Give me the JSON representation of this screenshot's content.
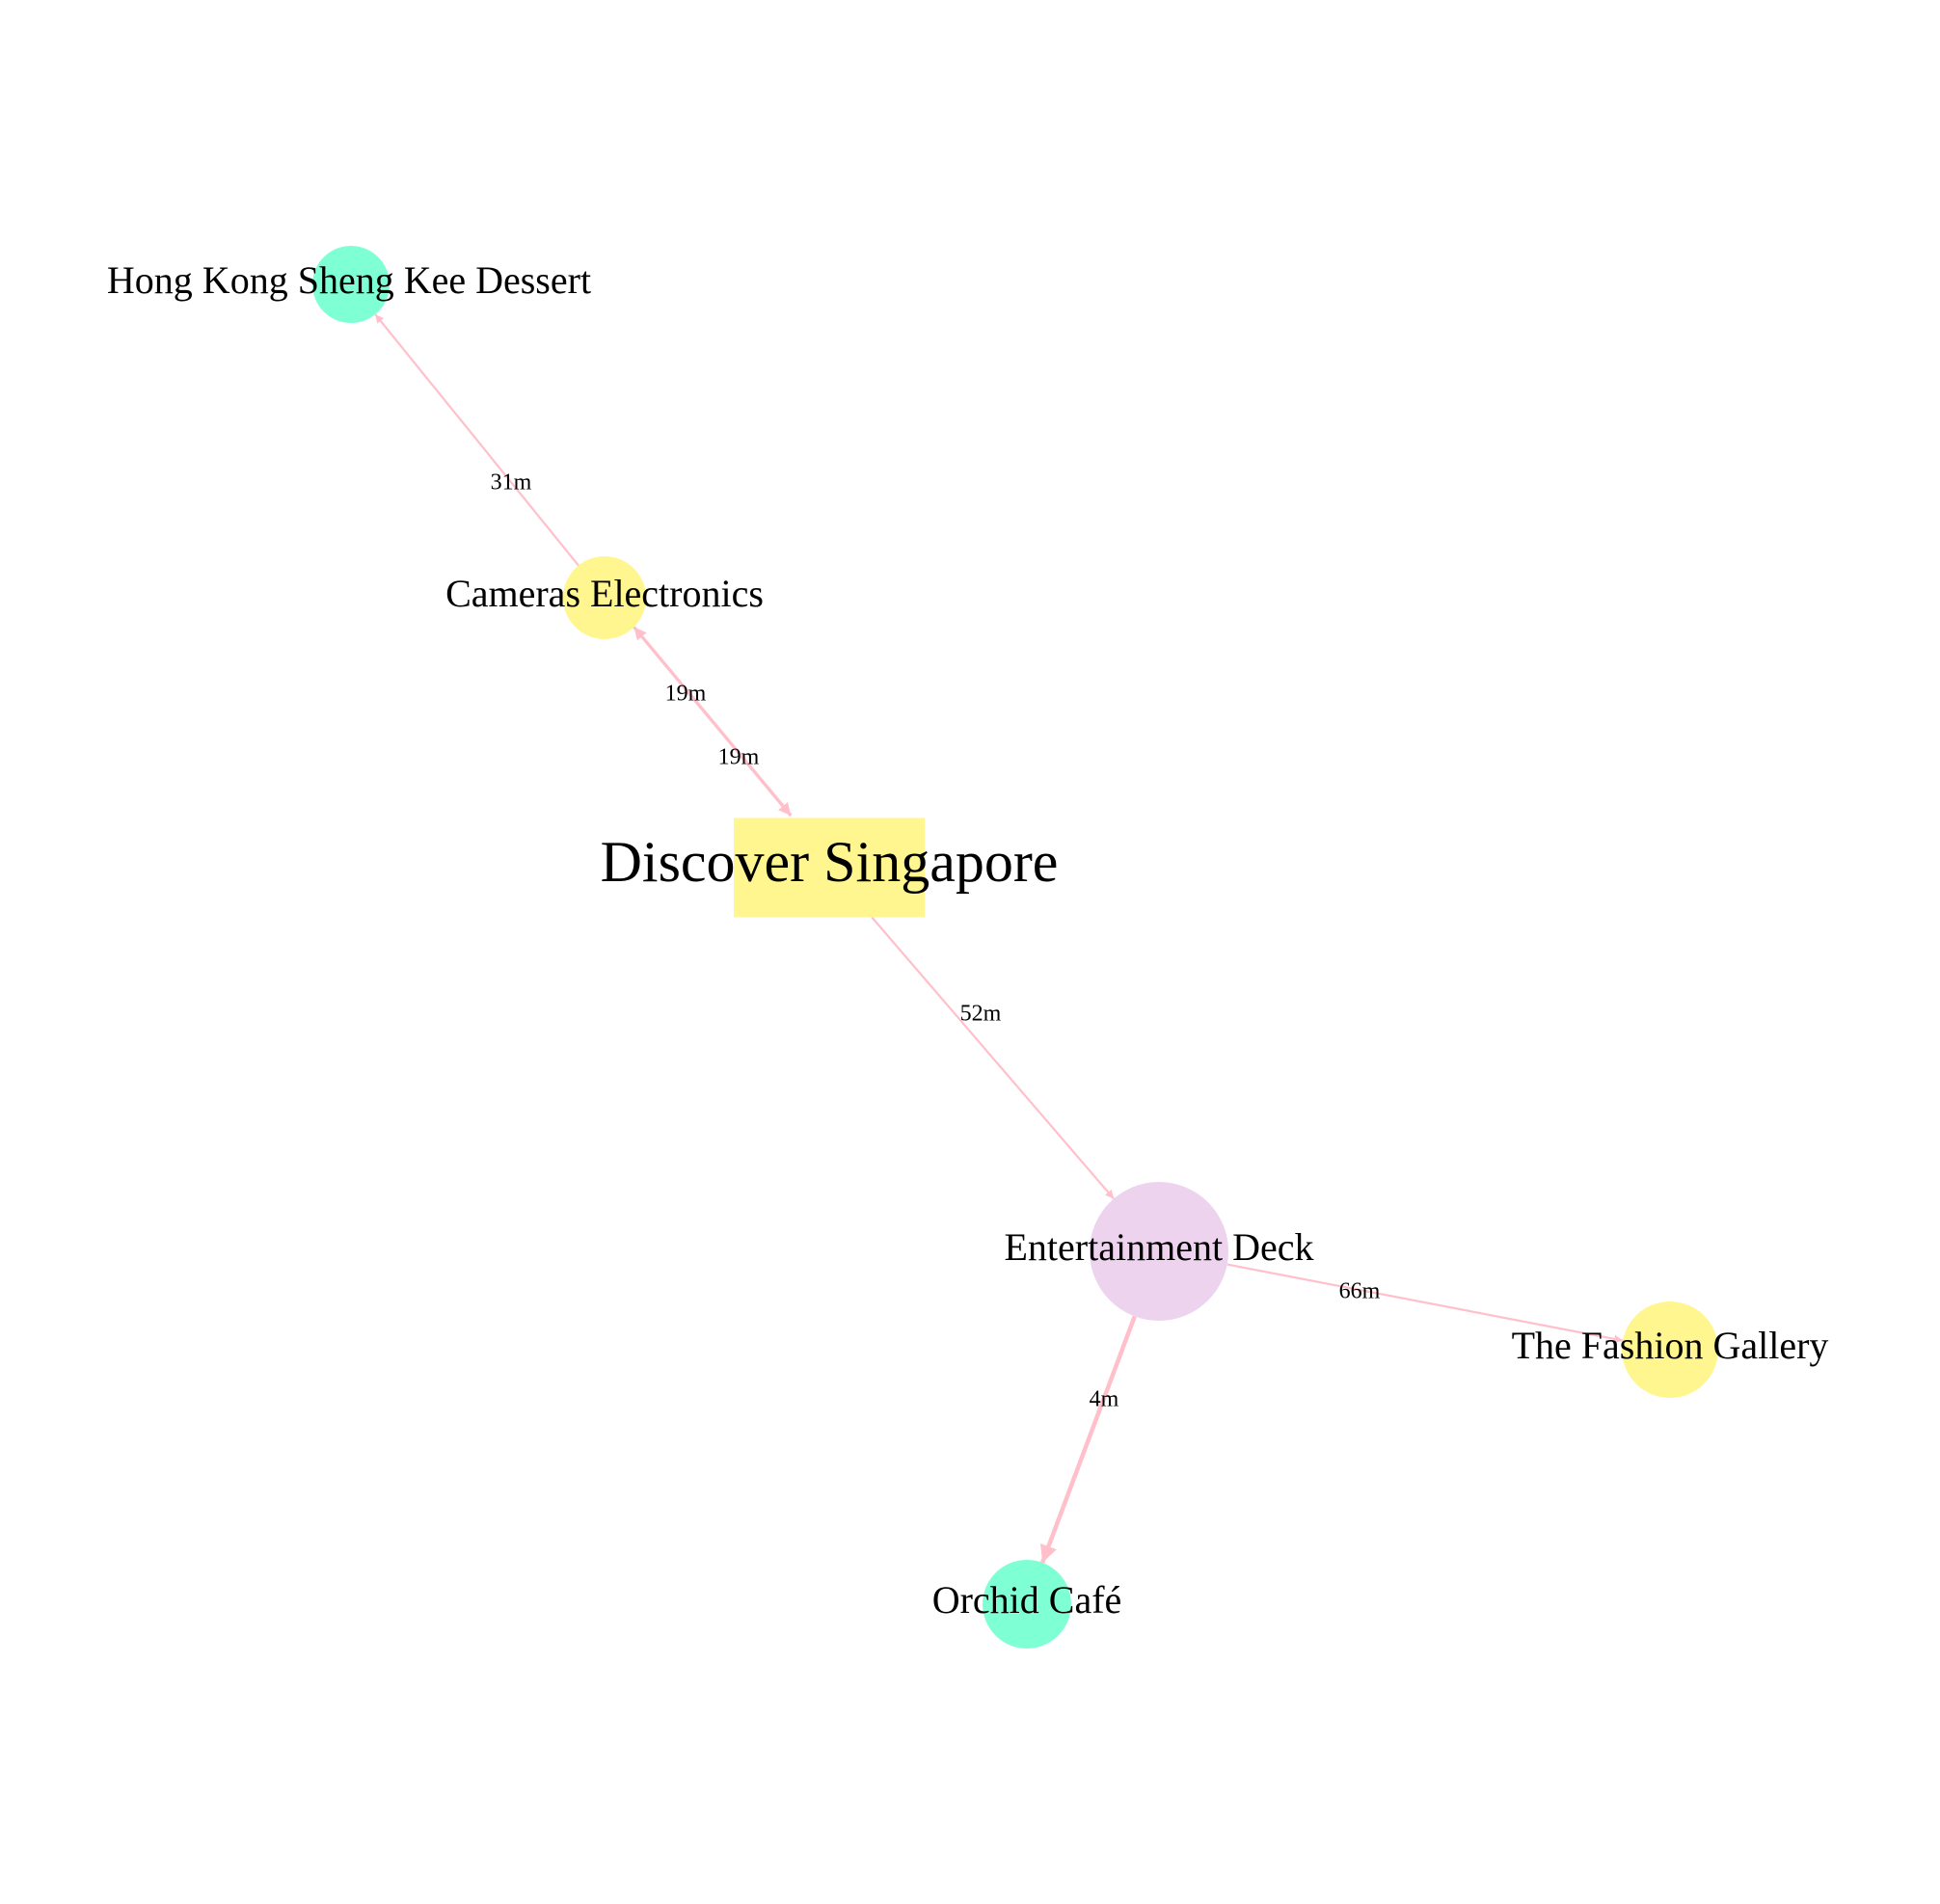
{
  "colors": {
    "edge": "#ffc0cb",
    "yellow": "#fff68f",
    "aquamarine": "#7fffd4",
    "lavender": "#eed3ee"
  },
  "nodes": [
    {
      "id": "discover",
      "label": "Discover Singapore",
      "shape": "box",
      "color": "yellow"
    },
    {
      "id": "cameras",
      "label": "Cameras Electronics",
      "shape": "circle",
      "color": "yellow"
    },
    {
      "id": "hongkong",
      "label": "Hong Kong Sheng Kee Dessert",
      "shape": "circle",
      "color": "aquamarine"
    },
    {
      "id": "entertainment",
      "label": "Entertainment Deck",
      "shape": "circle",
      "color": "lavender"
    },
    {
      "id": "fashion",
      "label": "The Fashion Gallery",
      "shape": "circle",
      "color": "yellow"
    },
    {
      "id": "orchid",
      "label": "Orchid Café",
      "shape": "circle",
      "color": "aquamarine"
    }
  ],
  "edges": [
    {
      "from": "cameras",
      "to": "hongkong",
      "label": "31m"
    },
    {
      "from": "cameras",
      "to": "discover",
      "label": "19m"
    },
    {
      "from": "discover",
      "to": "cameras",
      "label": "19m"
    },
    {
      "from": "discover",
      "to": "entertainment",
      "label": "52m"
    },
    {
      "from": "entertainment",
      "to": "fashion",
      "label": "66m"
    },
    {
      "from": "entertainment",
      "to": "orchid",
      "label": "4m"
    }
  ]
}
